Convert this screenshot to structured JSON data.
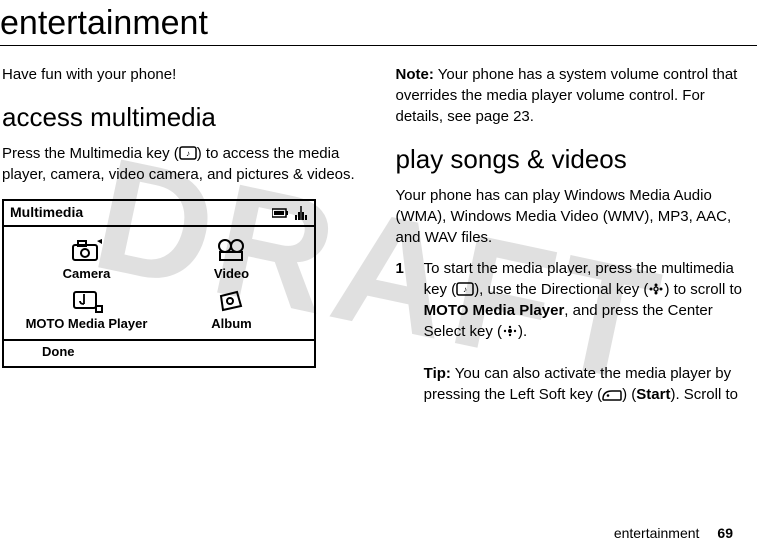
{
  "page": {
    "title": "entertainment",
    "watermark": "DRAFT"
  },
  "left": {
    "intro": "Have fun with your phone!",
    "heading": "access multimedia",
    "body_a": "Press the Multimedia key (",
    "body_b": ") to access the media player, camera, video camera, and pictures & videos.",
    "phone": {
      "title": "Multimedia",
      "items": {
        "camera": "Camera",
        "video": "Video",
        "player": "MOTO Media Player",
        "album": "Album"
      },
      "done": "Done"
    }
  },
  "right": {
    "note_label": "Note:",
    "note_text": " Your phone has a system volume control that overrides the media player volume control. For details, see page 23.",
    "heading": "play songs & videos",
    "intro": "Your phone has can play Windows Media Audio (WMA), Windows Media Video (WMV), MP3, AAC, and WAV files.",
    "step_num": "1",
    "step_a": "To start the media player, press the multimedia key (",
    "step_b": "), use the Directional key (",
    "step_c": ") to scroll to ",
    "step_player": "MOTO Media Player",
    "step_d": ", and press the Center Select key (",
    "step_e": ").",
    "tip_label": "Tip:",
    "tip_a": " You can also activate the media player by pressing the Left Soft key (",
    "tip_b": ") (",
    "tip_start": "Start",
    "tip_c": "). Scroll to"
  },
  "footer": {
    "section": "entertainment",
    "page_number": "69"
  }
}
